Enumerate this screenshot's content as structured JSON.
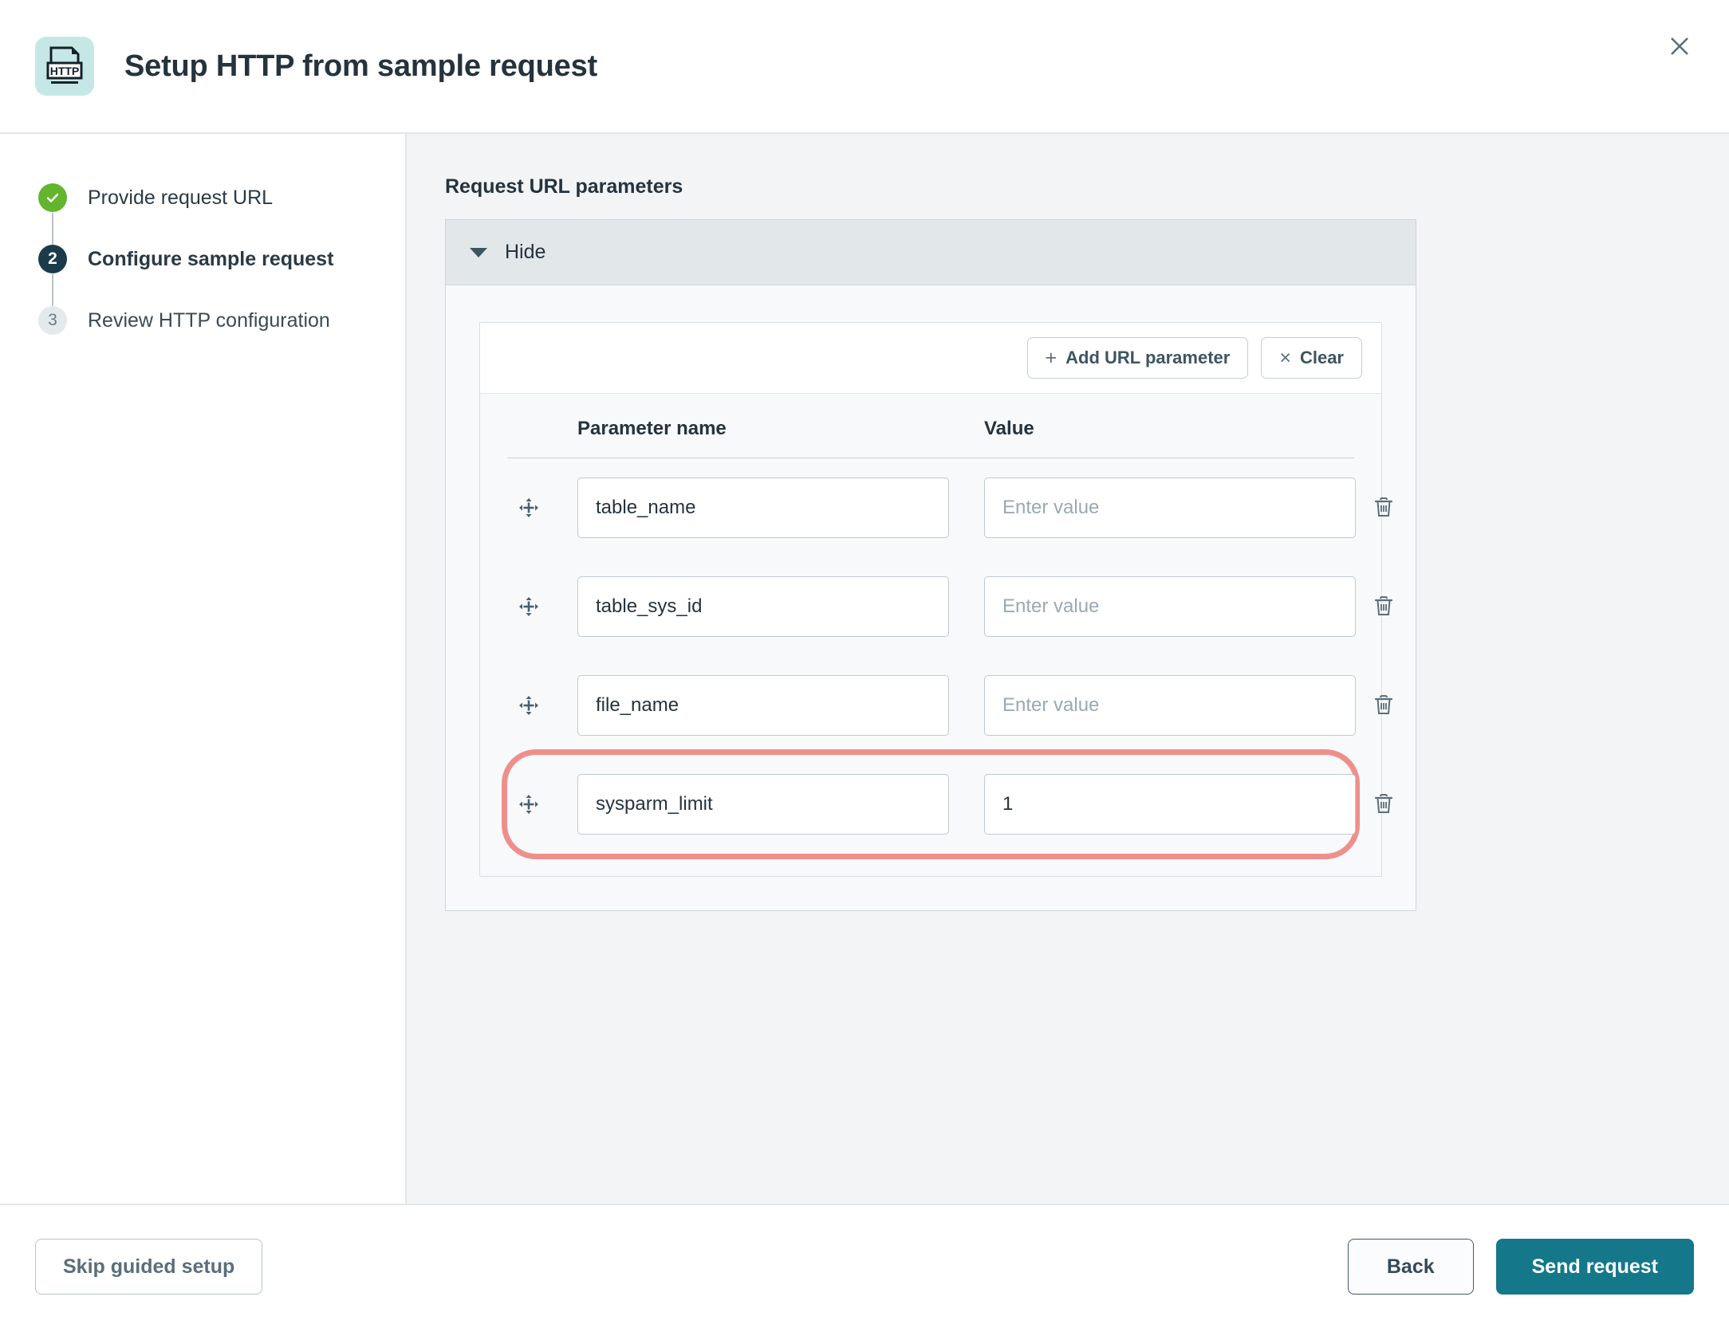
{
  "header": {
    "title": "Setup HTTP from sample request",
    "icon_name": "http-file-icon",
    "icon_label": "HTTP",
    "icon_bg": "#c5e8e7",
    "close_icon": "close-icon"
  },
  "stepper": {
    "steps": [
      {
        "number": "1",
        "marker": "✓",
        "label": "Provide request URL",
        "state": "done"
      },
      {
        "number": "2",
        "marker": "2",
        "label": "Configure sample request",
        "state": "current"
      },
      {
        "number": "3",
        "marker": "3",
        "label": "Review HTTP configuration",
        "state": "pending"
      }
    ]
  },
  "main": {
    "section_title": "Request URL parameters",
    "panel": {
      "toggle_label": "Hide",
      "toolbar": {
        "add_label": "Add URL parameter",
        "add_glyph": "+",
        "clear_label": "Clear",
        "clear_glyph": "×"
      },
      "table": {
        "columns": [
          "Parameter name",
          "Value"
        ],
        "value_placeholder": "Enter value",
        "rows": [
          {
            "name": "table_name",
            "value": "",
            "highlighted": false
          },
          {
            "name": "table_sys_id",
            "value": "",
            "highlighted": false
          },
          {
            "name": "file_name",
            "value": "",
            "highlighted": false
          },
          {
            "name": "sysparm_limit",
            "value": "1",
            "highlighted": true
          }
        ]
      }
    }
  },
  "footer": {
    "skip_label": "Skip guided setup",
    "back_label": "Back",
    "send_label": "Send request"
  },
  "colors": {
    "accent_teal": "#14788a",
    "step_done_green": "#62b52c",
    "step_current_navy": "#1b3b4b",
    "highlight_coral": "#ef8f8c",
    "panel_header_gray": "#e2e7ea",
    "main_bg": "#f2f4f6"
  }
}
